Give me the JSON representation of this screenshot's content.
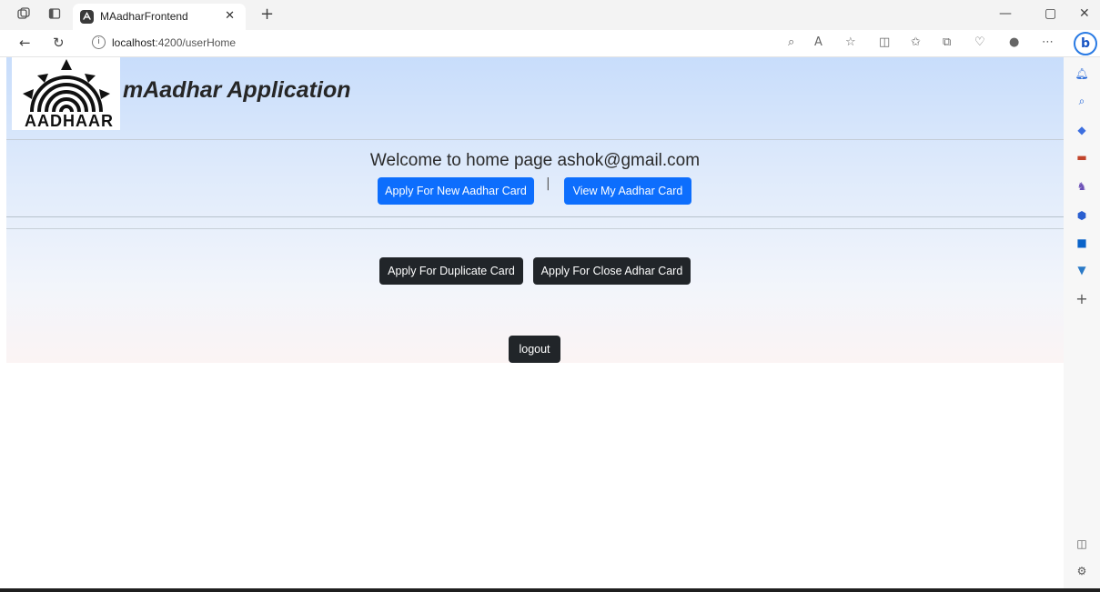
{
  "browser": {
    "tab_title": "MAadharFrontend",
    "url_host": "localhost",
    "url_rest": ":4200/userHome",
    "icons": {
      "workspaces": "workspaces-icon",
      "tab_actions": "tab-actions-icon",
      "tab_favicon": "angular-icon",
      "tab_close": "close-icon",
      "new_tab": "plus-icon",
      "minimize": "minimize-icon",
      "restore": "restore-icon",
      "close_window": "close-icon",
      "back": "back-arrow-icon",
      "refresh": "refresh-icon",
      "info": "info-icon",
      "read_aloud": "read-aloud-icon",
      "favorite": "star-icon",
      "split_screen": "split-screen-icon",
      "favorites": "favorites-icon",
      "collections": "collections-icon",
      "extensions": "heart-pulse-icon",
      "profile": "profile-icon",
      "more": "more-icon",
      "copilot": "bing-icon"
    },
    "sidebar_icons": [
      "bell-icon",
      "search-icon",
      "tag-icon",
      "briefcase-icon",
      "chess-icon",
      "hexagon-icon",
      "outlook-icon",
      "drop-icon",
      "add-icon",
      "sidebar-toggle-icon",
      "settings-icon"
    ]
  },
  "page": {
    "logo_text": "AADHAAR",
    "app_title": "mAadhar Application",
    "welcome": "Welcome to home page ashok@gmail.com",
    "buttons": {
      "apply_new": "Apply For New Aadhar Card",
      "separator": "|",
      "view": "View My Aadhar Card",
      "duplicate": "Apply For Duplicate Card",
      "close": "Apply For Close Adhar Card",
      "logout": "logout"
    }
  },
  "colors": {
    "primary": "#0d6efd",
    "dark": "#212529",
    "header_gradient_top": "#c8ddfb"
  }
}
